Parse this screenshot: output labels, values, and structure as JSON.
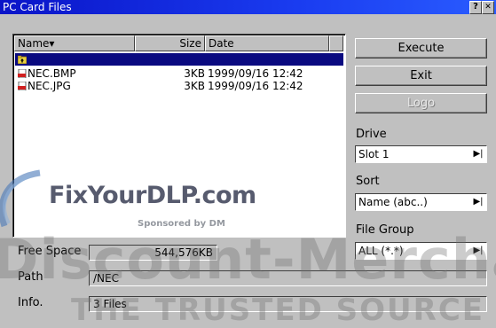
{
  "window": {
    "title": "PC Card Files",
    "help_btn": "?",
    "close_btn": "✕"
  },
  "list": {
    "headers": {
      "name": "Name▾",
      "size": "Size",
      "date": "Date"
    },
    "rows": [
      {
        "name": "",
        "size": "",
        "date": "",
        "icon": "folder-up-icon",
        "selected": true
      },
      {
        "name": "NEC.BMP",
        "size": "3KB",
        "date": "1999/09/16 12:42",
        "icon": "bmp-file-icon"
      },
      {
        "name": "NEC.JPG",
        "size": "3KB",
        "date": "1999/09/16 12:42",
        "icon": "jpg-file-icon"
      }
    ]
  },
  "buttons": {
    "execute": "Execute",
    "exit": "Exit",
    "logo": "Logo"
  },
  "drive": {
    "label": "Drive",
    "value": "Slot 1"
  },
  "sort": {
    "label": "Sort",
    "value": "Name (abc..)"
  },
  "file_group": {
    "label": "File Group",
    "value": "ALL (*.*)"
  },
  "info": {
    "free_space_label": "Free Space",
    "free_space_value": "544,576KB",
    "path_label": "Path",
    "path_value": "/NEC",
    "info_label": "Info.",
    "info_value": "3 Files"
  },
  "watermark": {
    "brand": "FixYourDLP.com",
    "sponsor": "Sponsored by DM",
    "banner": "Discount-Merchant",
    "tagline": "THE TRUSTED SOURCE FOR PR"
  },
  "colors": {
    "titlebar": "#0a14c8",
    "selection": "#0a0a80",
    "face": "#c0c0c0"
  }
}
